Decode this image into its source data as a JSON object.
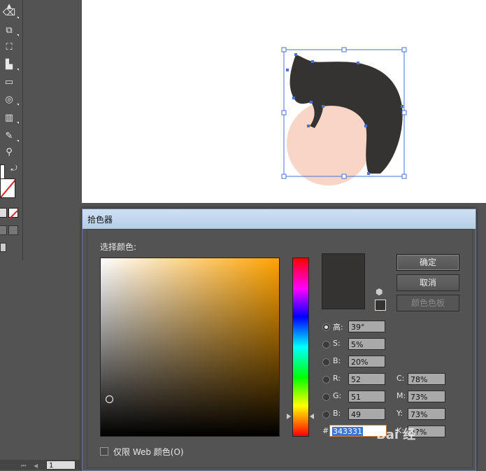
{
  "window": {
    "dialog_title": "拾色器"
  },
  "picker": {
    "select_label": "选择颜色:",
    "current_color": "#343331",
    "hue_field_color": "#ffa300"
  },
  "buttons": {
    "ok": "确定",
    "cancel": "取消",
    "swatches": "颜色色板"
  },
  "hsb": {
    "h_label": "高:",
    "h_value": "39°",
    "s_label": "S:",
    "s_value": "5%",
    "b_label": "B:",
    "b_value": "20%"
  },
  "rgb": {
    "r_label": "R:",
    "r_value": "52",
    "g_label": "G:",
    "g_value": "51",
    "b_label": "B:",
    "b_value": "49"
  },
  "cmyk": {
    "c_label": "C:",
    "c_value": "78%",
    "m_label": "M:",
    "m_value": "73%",
    "y_label": "Y:",
    "y_value": "73%",
    "k_label": "K:",
    "k_value": "4?%"
  },
  "hex": {
    "label": "#",
    "value": "343331"
  },
  "web_only_label": "仅限 Web 颜色(O)",
  "watermark": "Bai 经",
  "status": {
    "page": "1"
  },
  "icons": {
    "eraser": "eraser-icon",
    "scale": "scale-icon",
    "free-transform": "free-transform-icon",
    "graph": "column-graph-icon",
    "gradient": "gradient-icon",
    "blend": "blend-icon",
    "bar": "bar-graph-icon",
    "eyedropper": "eyedropper-icon",
    "zoom": "zoom-icon",
    "swap": "swap-colors-icon",
    "gamut": "out-of-gamut-cube-icon"
  }
}
